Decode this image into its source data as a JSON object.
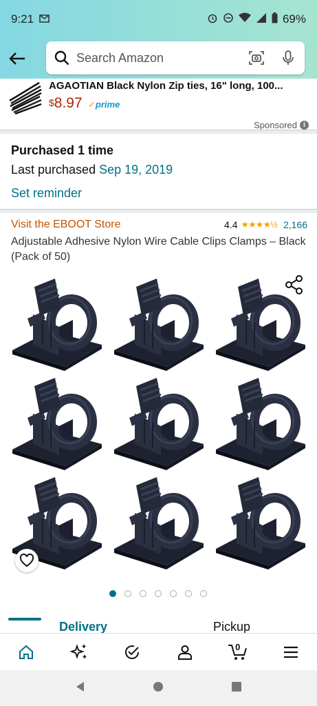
{
  "status_bar": {
    "time": "9:21",
    "mail_icon": "M",
    "battery": "69%"
  },
  "search": {
    "placeholder": "Search Amazon"
  },
  "sponsored_ad": {
    "title": "AGAOTIAN Black Nylon Zip ties, 16\" long, 100...",
    "price_symbol": "$",
    "price": "8.97",
    "prime": "prime",
    "sponsored_label": "Sponsored",
    "info": "i"
  },
  "purchase": {
    "times": "Purchased 1 time",
    "last_prefix": "Last purchased ",
    "last_date": "Sep 19, 2019",
    "reminder": "Set reminder"
  },
  "product": {
    "store": "Visit the EBOOT Store",
    "rating": "4.4",
    "stars": "★★★★½",
    "review_count": "2,166",
    "title": "Adjustable Adhesive Nylon Wire Cable Clips Clamps – Black (Pack of 50)",
    "image_count": 7,
    "active_image": 0
  },
  "tabs": {
    "delivery": "Delivery",
    "pickup": "Pickup"
  },
  "bottom_nav": {
    "items": [
      "home-icon",
      "sparkle-icon",
      "check-circle-icon",
      "account-icon",
      "cart-icon",
      "menu-icon"
    ],
    "cart_count": "0"
  },
  "colors": {
    "header_gradient_start": "#84d8e3",
    "header_gradient_end": "#a6e4d0",
    "link": "#007185",
    "price": "#b12704",
    "store": "#c45500",
    "star": "#f2a40b"
  }
}
